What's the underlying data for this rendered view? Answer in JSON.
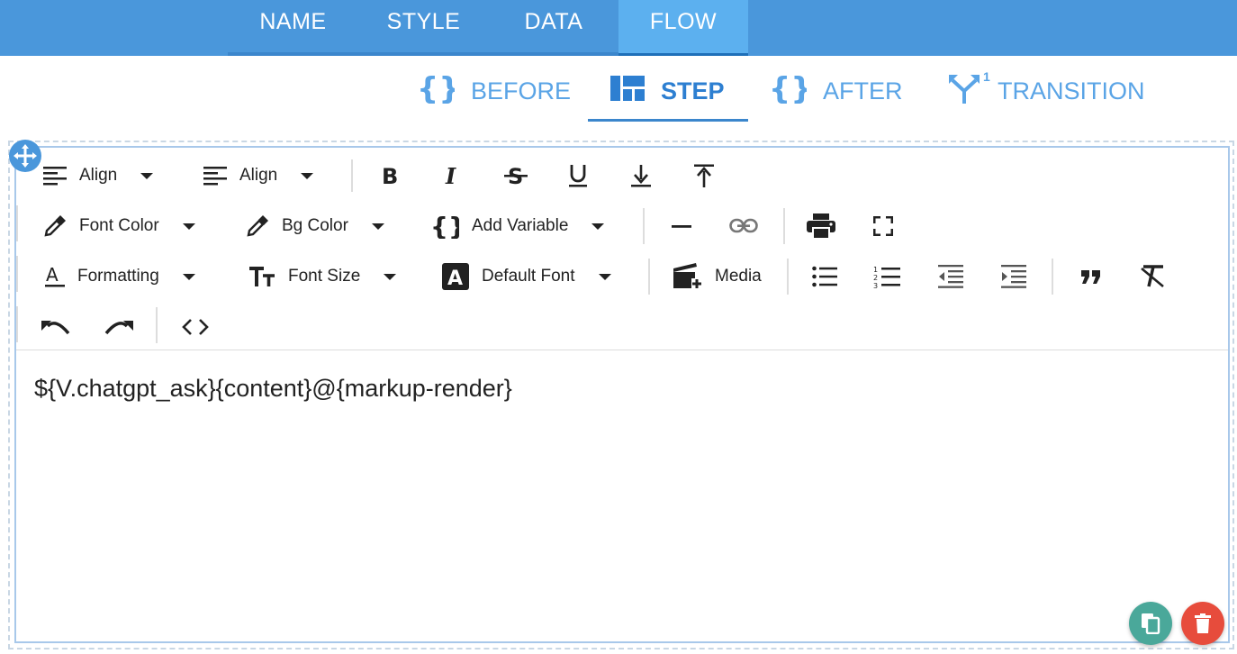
{
  "top_tabs": [
    {
      "label": "NAME"
    },
    {
      "label": "STYLE"
    },
    {
      "label": "DATA"
    },
    {
      "label": "FLOW"
    }
  ],
  "active_top_tab": "FLOW",
  "sub_tabs": [
    {
      "label": "BEFORE",
      "icon": "braces-icon"
    },
    {
      "label": "STEP",
      "icon": "layout-icon"
    },
    {
      "label": "AFTER",
      "icon": "braces-icon"
    },
    {
      "label": "TRANSITION",
      "icon": "fork-icon",
      "badge": "1"
    }
  ],
  "active_sub_tab": "STEP",
  "toolbar": {
    "align1": "Align",
    "align2": "Align",
    "font_color": "Font Color",
    "bg_color": "Bg Color",
    "add_variable": "Add Variable",
    "formatting": "Formatting",
    "font_size": "Font Size",
    "default_font": "Default Font",
    "media": "Media"
  },
  "editor": {
    "content": "${V.chatgpt_ask}{content}@{markup-render}"
  },
  "colors": {
    "primary": "#4a97db",
    "active_tab": "#5cb0ef",
    "copy_button": "#4aa89a",
    "delete_button": "#e74c3c"
  }
}
